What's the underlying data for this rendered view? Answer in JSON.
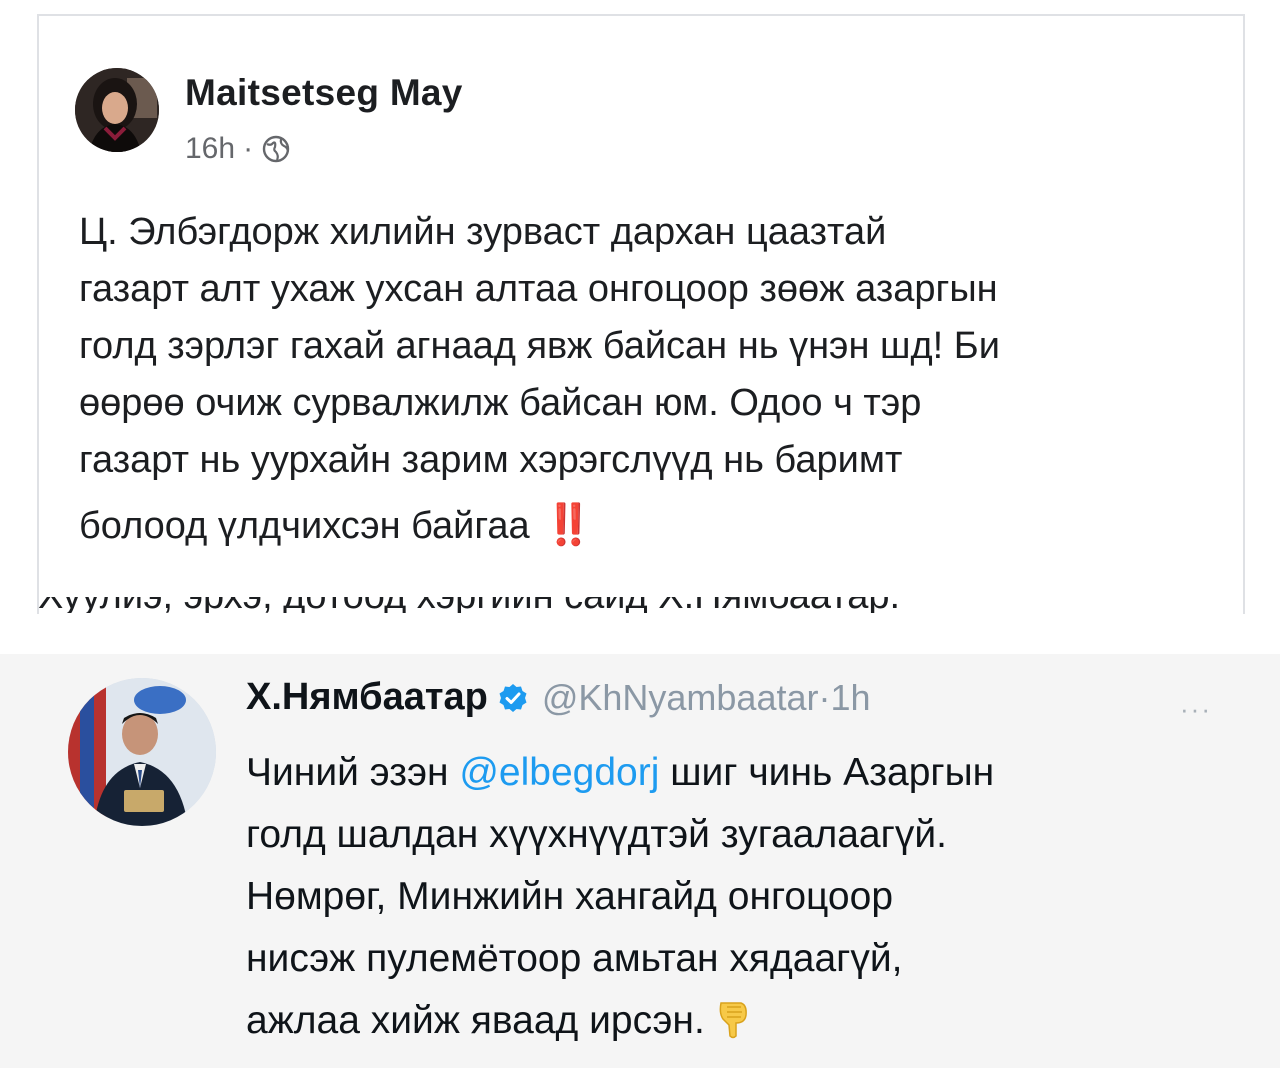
{
  "facebook_post": {
    "author": "Maitsetseg May",
    "time": "16h",
    "separator": "·",
    "privacy_icon": "globe-icon",
    "text_lines": [
      "Ц. Элбэгдорж хилийн зурваст дархан цаазтай",
      "газарт алт ухаж ухсан алтаа онгоцоор зөөж азаргын",
      "голд зэрлэг гахай агнаад явж байсан нь үнэн шд! Би",
      "өөрөө очиж сурвалжилж байсан юм. Одоо ч тэр",
      "газарт нь уурхайн зарим хэрэгслүүд нь баримт",
      "болоод үлдчихсэн байгаа"
    ],
    "emoji": "‼️",
    "cut_text": "Хуулиэ, эрхэ, дотоод хэргийн сайд Х.Нямбаатар."
  },
  "tweet": {
    "name": "Х.Нямбаатар",
    "verified_icon": "verified-badge-icon",
    "handle": "@KhNyambaatar",
    "time": "1h",
    "separator": "·",
    "more_label": "···",
    "line1_before": "Чиний эзэн ",
    "mention": "@elbegdorj",
    "line1_after": " шиг чинь Азаргын",
    "lines": [
      "голд шалдан хүүхнүүдтэй зугаалаагүй.",
      "Нөмрөг, Минжийн хангайд онгоцоор",
      "нисэж пулемётоор амьтан хядаагүй,"
    ],
    "last_line": "ажлаа хийж яваад ирсэн.",
    "emoji_icon": "pointing-down-hand-icon"
  },
  "colors": {
    "card_border": "#dfe1e5",
    "text_primary": "#1c1e21",
    "text_secondary": "#65676b",
    "tweet_bg": "#f5f5f5",
    "mention": "#1d9bf0",
    "verified": "#1d9bf0",
    "handle": "#8b98a5",
    "bang": "#e2231a"
  }
}
